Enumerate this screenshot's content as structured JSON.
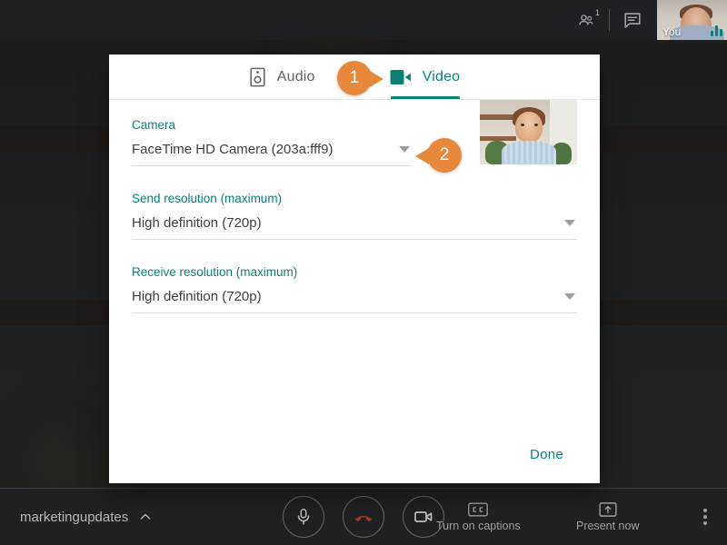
{
  "meeting": {
    "top_bar": {
      "people_icon": "people-icon",
      "participant_count": "1",
      "chat_icon": "chat-icon",
      "self_view_label": "You",
      "audio_level_icon": "audio-level-icon"
    },
    "bottom_bar": {
      "meeting_code": "marketingupdates",
      "meeting_code_chevron": "chevron-up-icon",
      "mic_icon": "microphone-icon",
      "hangup_icon": "hangup-phone-icon",
      "camera_icon": "video-camera-icon",
      "captions_label": "Turn on captions",
      "captions_icon": "closed-captions-icon",
      "present_label": "Present now",
      "present_icon": "present-screen-icon",
      "more_options_icon": "more-options-kebab-icon"
    }
  },
  "dialog": {
    "tabs": [
      {
        "id": "audio",
        "label": "Audio",
        "icon": "speaker-icon",
        "active": false
      },
      {
        "id": "video",
        "label": "Video",
        "icon": "video-camera-icon",
        "active": true
      }
    ],
    "fields": [
      {
        "id": "camera",
        "label": "Camera",
        "value": "FaceTime HD Camera (203a:fff9)",
        "caret_icon": "chevron-down-icon"
      },
      {
        "id": "send-resolution",
        "label": "Send resolution (maximum)",
        "value": "High definition (720p)",
        "caret_icon": "chevron-down-icon"
      },
      {
        "id": "receive-resolution",
        "label": "Receive resolution (maximum)",
        "value": "High definition (720p)",
        "caret_icon": "chevron-down-icon"
      }
    ],
    "preview": {
      "name": "camera-preview"
    },
    "done_label": "Done"
  },
  "callouts": [
    {
      "id": "1",
      "number": "1",
      "direction": "right"
    },
    {
      "id": "2",
      "number": "2",
      "direction": "left"
    }
  ],
  "colors": {
    "accent_teal": "#0b8174",
    "callout_orange": "#e8883a",
    "hangup_red": "#a33c2e",
    "text_primary": "#3c4043",
    "text_muted": "#5f6368"
  }
}
